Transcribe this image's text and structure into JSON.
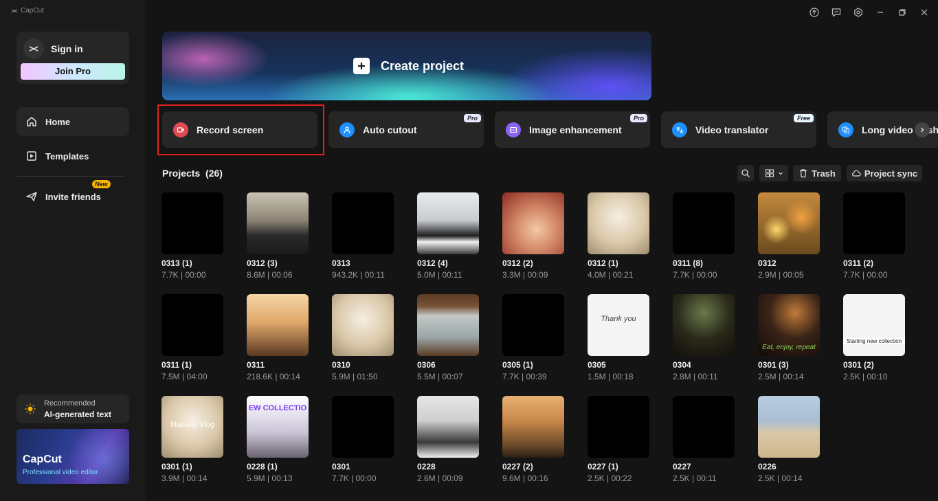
{
  "app": {
    "title": "CapCut"
  },
  "sidebar": {
    "sign_in": "Sign in",
    "join_pro": "Join Pro",
    "nav": [
      {
        "label": "Home"
      },
      {
        "label": "Templates"
      },
      {
        "label": "Invite friends",
        "badge": "New"
      }
    ],
    "recommend": {
      "small": "Recommended",
      "big": "AI-generated text"
    },
    "promo": {
      "title": "CapCut",
      "subtitle": "Professional video editor"
    }
  },
  "create": {
    "label": "Create project"
  },
  "tools": [
    {
      "label": "Record screen",
      "badge": "",
      "color": "#e04a52"
    },
    {
      "label": "Auto cutout",
      "badge": "Pro",
      "color": "#1d8fff"
    },
    {
      "label": "Image enhancement",
      "badge": "Pro",
      "color": "#8a63f5"
    },
    {
      "label": "Video translator",
      "badge": "Free",
      "color": "#1d8fff"
    },
    {
      "label": "Long video to sh",
      "badge": "",
      "color": "#1d8fff"
    }
  ],
  "projects": {
    "title": "Projects",
    "count": "(26)",
    "trash_label": "Trash",
    "sync_label": "Project sync",
    "items": [
      {
        "name": "0313 (1)",
        "meta": "7.7K | 00:00",
        "thumb": "black"
      },
      {
        "name": "0312 (3)",
        "meta": "8.6M | 00:06",
        "thumb": "street"
      },
      {
        "name": "0313",
        "meta": "943.2K | 00:11",
        "thumb": "black"
      },
      {
        "name": "0312 (4)",
        "meta": "5.0M | 00:11",
        "thumb": "piano"
      },
      {
        "name": "0312 (2)",
        "meta": "3.3M | 00:09",
        "thumb": "warm"
      },
      {
        "name": "0312 (1)",
        "meta": "4.0M | 00:21",
        "thumb": "light"
      },
      {
        "name": "0311 (8)",
        "meta": "7.7K | 00:00",
        "thumb": "black"
      },
      {
        "name": "0312",
        "meta": "2.9M | 00:05",
        "thumb": "bokeh"
      },
      {
        "name": "0311 (2)",
        "meta": "7.7K | 00:00",
        "thumb": "black"
      },
      {
        "name": "0311 (1)",
        "meta": "7.5M | 04:00",
        "thumb": "black"
      },
      {
        "name": "0311",
        "meta": "218.6K | 00:14",
        "thumb": "sunset"
      },
      {
        "name": "0310",
        "meta": "5.9M | 01:50",
        "thumb": "light"
      },
      {
        "name": "0306",
        "meta": "5.5M | 00:07",
        "thumb": "window"
      },
      {
        "name": "0305 (1)",
        "meta": "7.7K | 00:39",
        "thumb": "black"
      },
      {
        "name": "0305",
        "meta": "1.5M | 00:18",
        "thumb": "white",
        "text": "Thank you"
      },
      {
        "name": "0304",
        "meta": "2.8M | 00:11",
        "thumb": "dinner"
      },
      {
        "name": "0301 (3)",
        "meta": "2.5M | 00:14",
        "thumb": "dark",
        "text": "Eat, enjoy, repeat"
      },
      {
        "name": "0301 (2)",
        "meta": "2.5K | 00:10",
        "thumb": "white",
        "text": "Starting new collection"
      },
      {
        "name": "0301 (1)",
        "meta": "3.9M | 00:14",
        "thumb": "light",
        "text": "Makeup Vlog"
      },
      {
        "name": "0228 (1)",
        "meta": "5.9M | 00:13",
        "thumb": "shop",
        "text": "EW COLLECTIO"
      },
      {
        "name": "0301",
        "meta": "7.7K | 00:00",
        "thumb": "black"
      },
      {
        "name": "0228",
        "meta": "2.6M | 00:09",
        "thumb": "office"
      },
      {
        "name": "0227 (2)",
        "meta": "9.6M | 00:16",
        "thumb": "beach"
      },
      {
        "name": "0227 (1)",
        "meta": "2.5K | 00:22",
        "thumb": "black"
      },
      {
        "name": "0227",
        "meta": "2.5K | 00:11",
        "thumb": "black"
      },
      {
        "name": "0226",
        "meta": "2.5K | 00:14",
        "thumb": "sand"
      }
    ]
  }
}
